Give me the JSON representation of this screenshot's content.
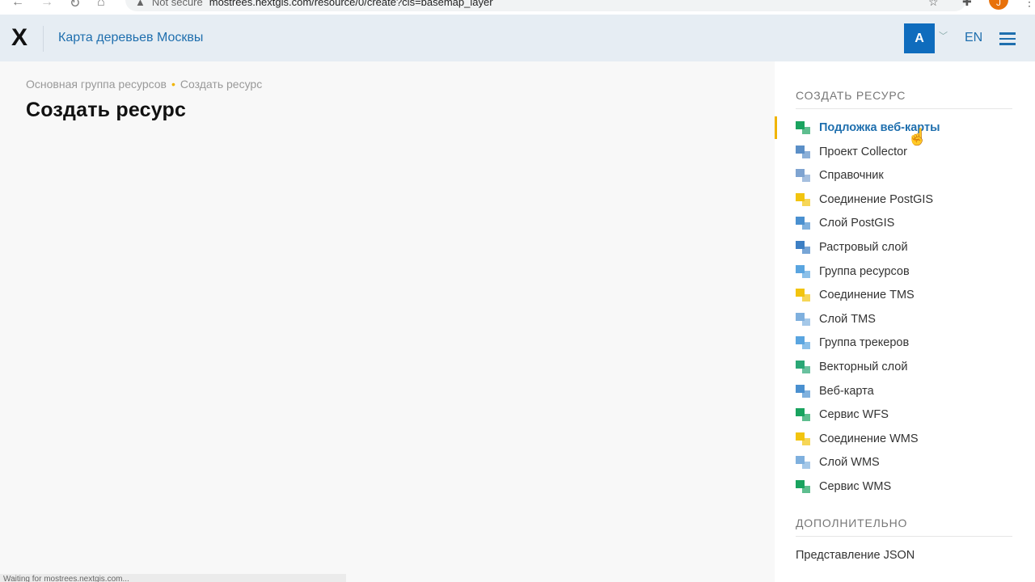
{
  "browser": {
    "security": "Not secure",
    "url": "mostrees.nextgis.com/resource/0/create?cls=basemap_layer",
    "profile": "J",
    "status": "Waiting for mostrees.nextgis.com..."
  },
  "header": {
    "logo": "X",
    "title": "Карта деревьев Москвы",
    "user": "A",
    "lang": "EN"
  },
  "breadcrumb": [
    "Основная группа ресурсов",
    "Создать ресурс"
  ],
  "page_title": "Создать ресурс",
  "sidebar": {
    "create_title": "СОЗДАТЬ РЕСУРС",
    "items": [
      {
        "label": "Подложка веб-карты",
        "icon": "basemap-icon",
        "color": "#1aa35f"
      },
      {
        "label": "Проект Collector",
        "icon": "collector-icon",
        "color": "#5b8fc7"
      },
      {
        "label": "Справочник",
        "icon": "lookup-table-icon",
        "color": "#7fa4d1"
      },
      {
        "label": "Соединение PostGIS",
        "icon": "postgis-connection-icon",
        "color": "#f2c40f"
      },
      {
        "label": "Слой PostGIS",
        "icon": "postgis-layer-icon",
        "color": "#4a90d0"
      },
      {
        "label": "Растровый слой",
        "icon": "raster-layer-icon",
        "color": "#3d7fc4"
      },
      {
        "label": "Группа ресурсов",
        "icon": "folder-icon",
        "color": "#5aa5e0"
      },
      {
        "label": "Соединение TMS",
        "icon": "tms-connection-icon",
        "color": "#f2c40f"
      },
      {
        "label": "Слой TMS",
        "icon": "tms-layer-icon",
        "color": "#7fb0de"
      },
      {
        "label": "Группа трекеров",
        "icon": "tracker-group-icon",
        "color": "#5aa5e0"
      },
      {
        "label": "Векторный слой",
        "icon": "vector-layer-icon",
        "color": "#2aa776"
      },
      {
        "label": "Веб-карта",
        "icon": "webmap-icon",
        "color": "#4a90d0"
      },
      {
        "label": "Сервис WFS",
        "icon": "wfs-service-icon",
        "color": "#1aa35f"
      },
      {
        "label": "Соединение WMS",
        "icon": "wms-connection-icon",
        "color": "#f2c40f"
      },
      {
        "label": "Слой WMS",
        "icon": "wms-layer-icon",
        "color": "#7fb0de"
      },
      {
        "label": "Сервис WMS",
        "icon": "wms-service-icon",
        "color": "#1aa35f"
      }
    ],
    "extra_title": "ДОПОЛНИТЕЛЬНО",
    "extra_items": [
      {
        "label": "Представление JSON"
      }
    ]
  }
}
